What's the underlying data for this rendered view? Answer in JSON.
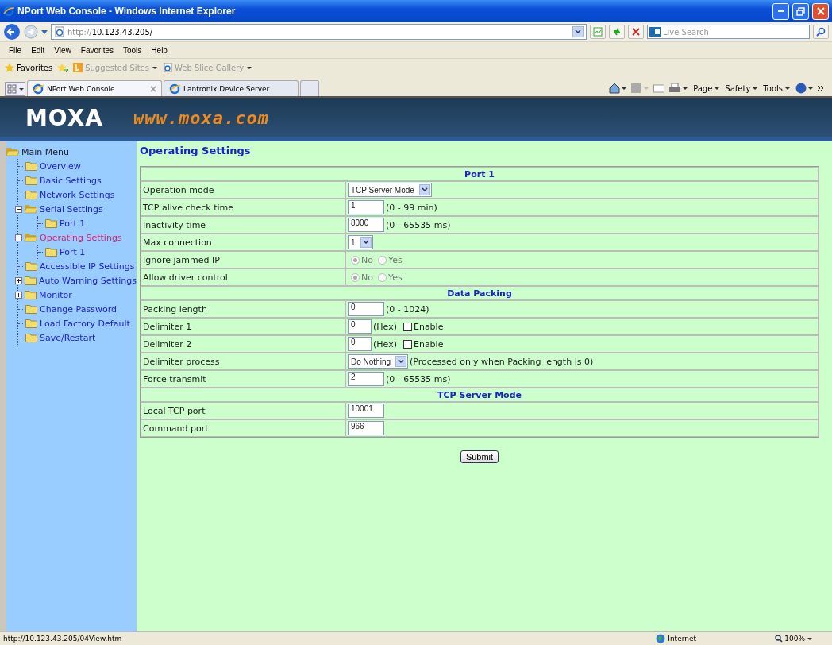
{
  "window": {
    "title": "NPort Web Console - Windows Internet Explorer"
  },
  "address_bar": {
    "scheme": "http://",
    "host": "10.123.43.205/",
    "search_placeholder": "Live Search"
  },
  "menu_bar": [
    "File",
    "Edit",
    "View",
    "Favorites",
    "Tools",
    "Help"
  ],
  "favorites_bar": {
    "label": "Favorites",
    "links": [
      "Suggested Sites",
      "Web Slice Gallery"
    ]
  },
  "tabs": [
    {
      "label": "NPort Web Console",
      "selected": true
    },
    {
      "label": "Lantronix Device Server",
      "selected": false
    }
  ],
  "command_bar": [
    "Page",
    "Safety",
    "Tools"
  ],
  "banner": {
    "logo": "MOXA",
    "url": "www.moxa.com"
  },
  "sidebar": {
    "label": "Main Menu",
    "children": [
      {
        "label": "Overview",
        "selected": false
      },
      {
        "label": "Basic Settings",
        "selected": false
      },
      {
        "label": "Network Settings",
        "selected": false
      },
      {
        "label": "Serial Settings",
        "selected": false,
        "expanded": true,
        "children": [
          {
            "label": "Port 1",
            "selected": false
          }
        ]
      },
      {
        "label": "Operating Settings",
        "selected": true,
        "expanded": true,
        "children": [
          {
            "label": "Port 1",
            "selected": false
          }
        ]
      },
      {
        "label": "Accessible IP Settings",
        "selected": false
      },
      {
        "label": "Auto Warning Settings",
        "selected": false,
        "expanded": false
      },
      {
        "label": "Monitor",
        "selected": false,
        "expanded": false
      },
      {
        "label": "Change Password",
        "selected": false
      },
      {
        "label": "Load Factory Default",
        "selected": false
      },
      {
        "label": "Save/Restart",
        "selected": false
      }
    ]
  },
  "page": {
    "title": "Operating Settings",
    "sections": [
      {
        "heading": "Port 1",
        "rows": [
          {
            "label": "Operation mode",
            "kind": "select",
            "value": "TCP Server Mode"
          },
          {
            "label": "TCP alive check time",
            "kind": "text",
            "value": "1",
            "note": "(0 - 99 min)"
          },
          {
            "label": "Inactivity time",
            "kind": "text",
            "value": "8000",
            "note": "(0 - 65535 ms)"
          },
          {
            "label": "Max connection",
            "kind": "select",
            "value": "1"
          },
          {
            "label": "Ignore jammed IP",
            "kind": "radio",
            "disabled": true,
            "options": [
              {
                "label": "No",
                "selected": true
              },
              {
                "label": "Yes",
                "selected": false
              }
            ]
          },
          {
            "label": "Allow driver control",
            "kind": "radio",
            "disabled": true,
            "options": [
              {
                "label": "No",
                "selected": true
              },
              {
                "label": "Yes",
                "selected": false
              }
            ]
          }
        ]
      },
      {
        "heading": "Data Packing",
        "rows": [
          {
            "label": "Packing length",
            "kind": "text",
            "value": "0",
            "note": "(0 - 1024)"
          },
          {
            "label": "Delimiter 1",
            "kind": "delimiter",
            "value": "0",
            "note": "(Hex)",
            "check_label": "Enable",
            "checked": false
          },
          {
            "label": "Delimiter 2",
            "kind": "delimiter",
            "value": "0",
            "note": "(Hex)",
            "check_label": "Enable",
            "checked": false
          },
          {
            "label": "Delimiter process",
            "kind": "select",
            "value": "Do Nothing",
            "note": "(Processed only when Packing length is 0)"
          },
          {
            "label": "Force transmit",
            "kind": "text",
            "value": "2",
            "note": "(0 - 65535 ms)"
          }
        ]
      },
      {
        "heading": "TCP Server Mode",
        "rows": [
          {
            "label": "Local TCP port",
            "kind": "text",
            "value": "10001"
          },
          {
            "label": "Command port",
            "kind": "text",
            "value": "966"
          }
        ]
      }
    ],
    "submit": "Submit"
  },
  "status_bar": {
    "url": "http://10.123.43.205/04View.htm",
    "zone": "Internet",
    "zoom": "100%"
  }
}
